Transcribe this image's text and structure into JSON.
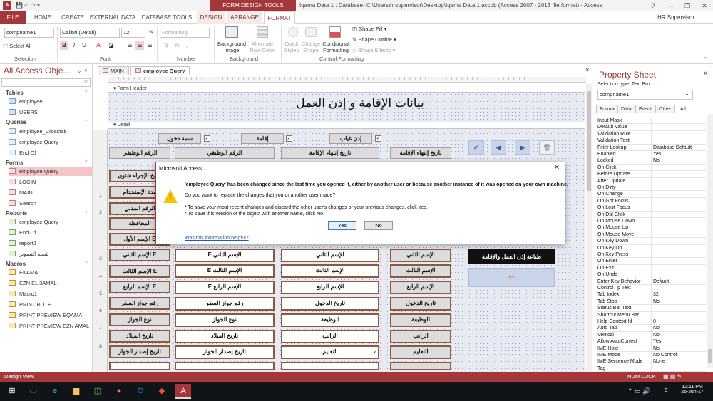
{
  "window": {
    "context_tab": "FORM DESIGN TOOLS",
    "title": "Iqama Data 1 : Database- C:\\Users\\hrsupervisor\\Desktop\\Iqama Data 1.accdb (Access 2007 - 2013 file format) - Access",
    "help": "?",
    "minimize": "—",
    "restore": "❐",
    "close": "✕"
  },
  "ribbon_tabs": [
    "FILE",
    "HOME",
    "CREATE",
    "EXTERNAL DATA",
    "DATABASE TOOLS",
    "DESIGN",
    "ARRANGE",
    "FORMAT"
  ],
  "user": "HR Supervisor",
  "ribbon": {
    "selection": {
      "object_value": "compname1",
      "select_all": "Select All",
      "group": "Selection"
    },
    "font": {
      "font_value": "Calibri (Detail)",
      "size_value": "12",
      "bold": "B",
      "italic": "I",
      "underline": "U",
      "font_color": "A",
      "group": "Font"
    },
    "number": {
      "format_value": "Formatting",
      "currency": "$",
      "percent": "%",
      "comma": ",",
      "group": "Number"
    },
    "background": {
      "bg_image": "Background Image",
      "alt_row": "Alternate Row Color",
      "group": "Background"
    },
    "control_formatting": {
      "quick_styles": "Quick Styles",
      "change_shape": "Change Shape",
      "conditional": "Conditional Formatting",
      "shape_fill": "Shape Fill",
      "shape_outline": "Shape Outline",
      "shape_effects": "Shape Effects",
      "group": "Control Formatting"
    }
  },
  "nav": {
    "title": "All Access Obje...",
    "sections": [
      {
        "name": "Tables",
        "items": [
          "employee",
          "USERS"
        ]
      },
      {
        "name": "Queries",
        "items": [
          "employee_Crosstab",
          "employee Query",
          "End Of"
        ]
      },
      {
        "name": "Forms",
        "items": [
          "employee Query",
          "LOGIN",
          "MAIN",
          "Search"
        ]
      },
      {
        "name": "Reports",
        "items": [
          "employee Query",
          "End Of",
          "report2",
          "شعبة التصوير"
        ]
      },
      {
        "name": "Macros",
        "items": [
          "EKAMA",
          "EZN EL 3AMAL",
          "Macro1",
          "PRINT BOTH",
          "PRINT PREVIEW EQAMA",
          "PRINT PREVIEW EZN AMAL"
        ]
      }
    ]
  },
  "doc_tabs": [
    "MAIN",
    "employee Query"
  ],
  "form": {
    "header_band": "Form Header",
    "detail_band": "Detail",
    "header_title": "بيانات الإقامة و إذن العمل",
    "check_labels": [
      "سمة دخول",
      "إقامة",
      "إذن غياب"
    ],
    "row_headers": [
      "الرقم الوظيفي",
      "الرقم الوظيفي",
      "تاريخ إنتهاء الإقامة",
      "تاريخ إنتهاء الإقامة"
    ],
    "left_labels": [
      "تاريخ الإجراء شئون",
      "مدة الإستخدام",
      "الرقم المدني",
      "المحافظة",
      "الإسم الأول E",
      "الإسم الثاني E",
      "الإسم الثالث E",
      "الإسم الرابع E",
      "رقم جواز السفر",
      "نوع الجواز",
      "تاريخ الميلاد",
      "تاريخ إصدار الجواز"
    ],
    "rows": [
      [
        "E الإسم الثاني",
        "الإسم الثاني",
        "الإسم الثاني"
      ],
      [
        "E الإسم الثالث",
        "الإسم الثالث",
        "الإسم الثالث"
      ],
      [
        "E الإسم الرابع",
        "الإسم الرابع",
        "الإسم الرابع"
      ],
      [
        "رقم جواز السفر",
        "تاريخ الدخول",
        "تاريخ الدخول"
      ],
      [
        "نوع الجواز",
        "الوظيفة",
        "الوظيفة"
      ],
      [
        "تاريخ الميلاد",
        "الراتب",
        "الراتب"
      ],
      [
        "تاريخ إصدار الجواز",
        "التعليم",
        "التعليم"
      ]
    ],
    "print_button": "طباعة إذن العمل والإقامة",
    "nav_icons": [
      "check-icon",
      "previous-icon",
      "next-icon",
      "delete-icon"
    ]
  },
  "row_numbers": [
    "1",
    "2",
    "3",
    "4",
    "5",
    "6",
    "7",
    "8"
  ],
  "property_sheet": {
    "title": "Property Sheet",
    "selection_type": "Selection type:  Text Box",
    "object": "compname1",
    "tabs": [
      "Format",
      "Data",
      "Event",
      "Other",
      "All"
    ],
    "rows": [
      [
        "Input Mask",
        ""
      ],
      [
        "Default Value",
        ""
      ],
      [
        "Validation Rule",
        ""
      ],
      [
        "Validation Text",
        ""
      ],
      [
        "Filter Lookup",
        "Database Default"
      ],
      [
        "Enabled",
        "Yes"
      ],
      [
        "Locked",
        "No"
      ],
      [
        "On Click",
        ""
      ],
      [
        "Before Update",
        ""
      ],
      [
        "After Update",
        ""
      ],
      [
        "On Dirty",
        ""
      ],
      [
        "On Change",
        ""
      ],
      [
        "On Got Focus",
        ""
      ],
      [
        "On Lost Focus",
        ""
      ],
      [
        "On Dbl Click",
        ""
      ],
      [
        "On Mouse Down",
        ""
      ],
      [
        "On Mouse Up",
        ""
      ],
      [
        "On Mouse Move",
        ""
      ],
      [
        "On Key Down",
        ""
      ],
      [
        "On Key Up",
        ""
      ],
      [
        "On Key Press",
        ""
      ],
      [
        "On Enter",
        ""
      ],
      [
        "On Exit",
        ""
      ],
      [
        "On Undo",
        ""
      ],
      [
        "Enter Key Behavior",
        "Default"
      ],
      [
        "ControlTip Text",
        ""
      ],
      [
        "Tab Index",
        "32"
      ],
      [
        "Tab Stop",
        "No"
      ],
      [
        "Status Bar Text",
        ""
      ],
      [
        "Shortcut Menu Bar",
        ""
      ],
      [
        "Help Context Id",
        "0"
      ],
      [
        "Auto Tab",
        "No"
      ],
      [
        "Vertical",
        "No"
      ],
      [
        "Allow AutoCorrect",
        "Yes"
      ],
      [
        "IME Hold",
        "No"
      ],
      [
        "IME Mode",
        "No Control"
      ],
      [
        "IME Sentence Mode",
        "None"
      ],
      [
        "Tag",
        ""
      ]
    ]
  },
  "status": {
    "left": "Design View",
    "num_lock": "NUM LOCK"
  },
  "dialog": {
    "title": "Microsoft Access",
    "line1": "'employee Query' has been changed since the last time you opened it, either by another user or because another instance of it was opened on your own machine.",
    "line2": "Do you want to replace the changes that you or another user made?",
    "line3": "* To save your most recent changes and discard the other user's changes or your previous changes, click Yes.",
    "line4": "* To save this version of the object with another name, click No.",
    "yes": "Yes",
    "no": "No",
    "help_link": "Was this information helpful?"
  },
  "taskbar": {
    "time": "12:11 PM",
    "date": "26-Jun-17",
    "lang": "E"
  },
  "colors": {
    "accent": "#a4373a",
    "warning": "#f5c400",
    "print_button_bg": "#111111"
  }
}
